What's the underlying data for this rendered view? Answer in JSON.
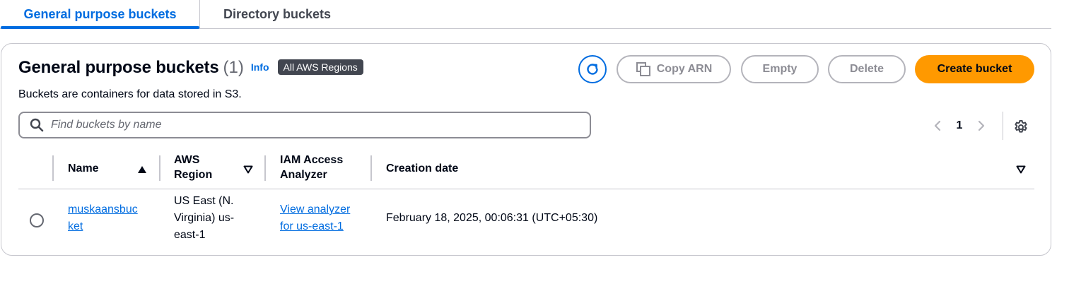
{
  "tabs": [
    {
      "label": "General purpose buckets",
      "active": true
    },
    {
      "label": "Directory buckets",
      "active": false
    }
  ],
  "panel": {
    "title": "General purpose buckets",
    "count": "(1)",
    "info_label": "Info",
    "region_badge": "All AWS Regions",
    "description": "Buckets are containers for data stored in S3."
  },
  "actions": {
    "refresh_icon": "refresh-icon",
    "copy_arn_label": "Copy ARN",
    "empty_label": "Empty",
    "delete_label": "Delete",
    "create_label": "Create bucket"
  },
  "search": {
    "placeholder": "Find buckets by name",
    "value": ""
  },
  "pagination": {
    "current_page": "1"
  },
  "table": {
    "columns": [
      {
        "label": "Name"
      },
      {
        "label_line1": "AWS",
        "label_line2": "Region"
      },
      {
        "label_line1": "IAM Access",
        "label_line2": "Analyzer"
      },
      {
        "label": "Creation date"
      }
    ],
    "rows": [
      {
        "name_line1": "muskaansbuc",
        "name_line2": "ket",
        "region_line1": "US East (N.",
        "region_line2": "Virginia) us-",
        "region_line3": "east-1",
        "analyzer_line1": "View analyzer",
        "analyzer_line2": "for us-east-1",
        "creation_date": "February 18, 2025, 00:06:31 (UTC+05:30)",
        "selected": false
      }
    ]
  },
  "colors": {
    "link": "#006ce0",
    "primary_button": "#ff9900",
    "badge": "#424650",
    "border": "#c6c6cd"
  }
}
